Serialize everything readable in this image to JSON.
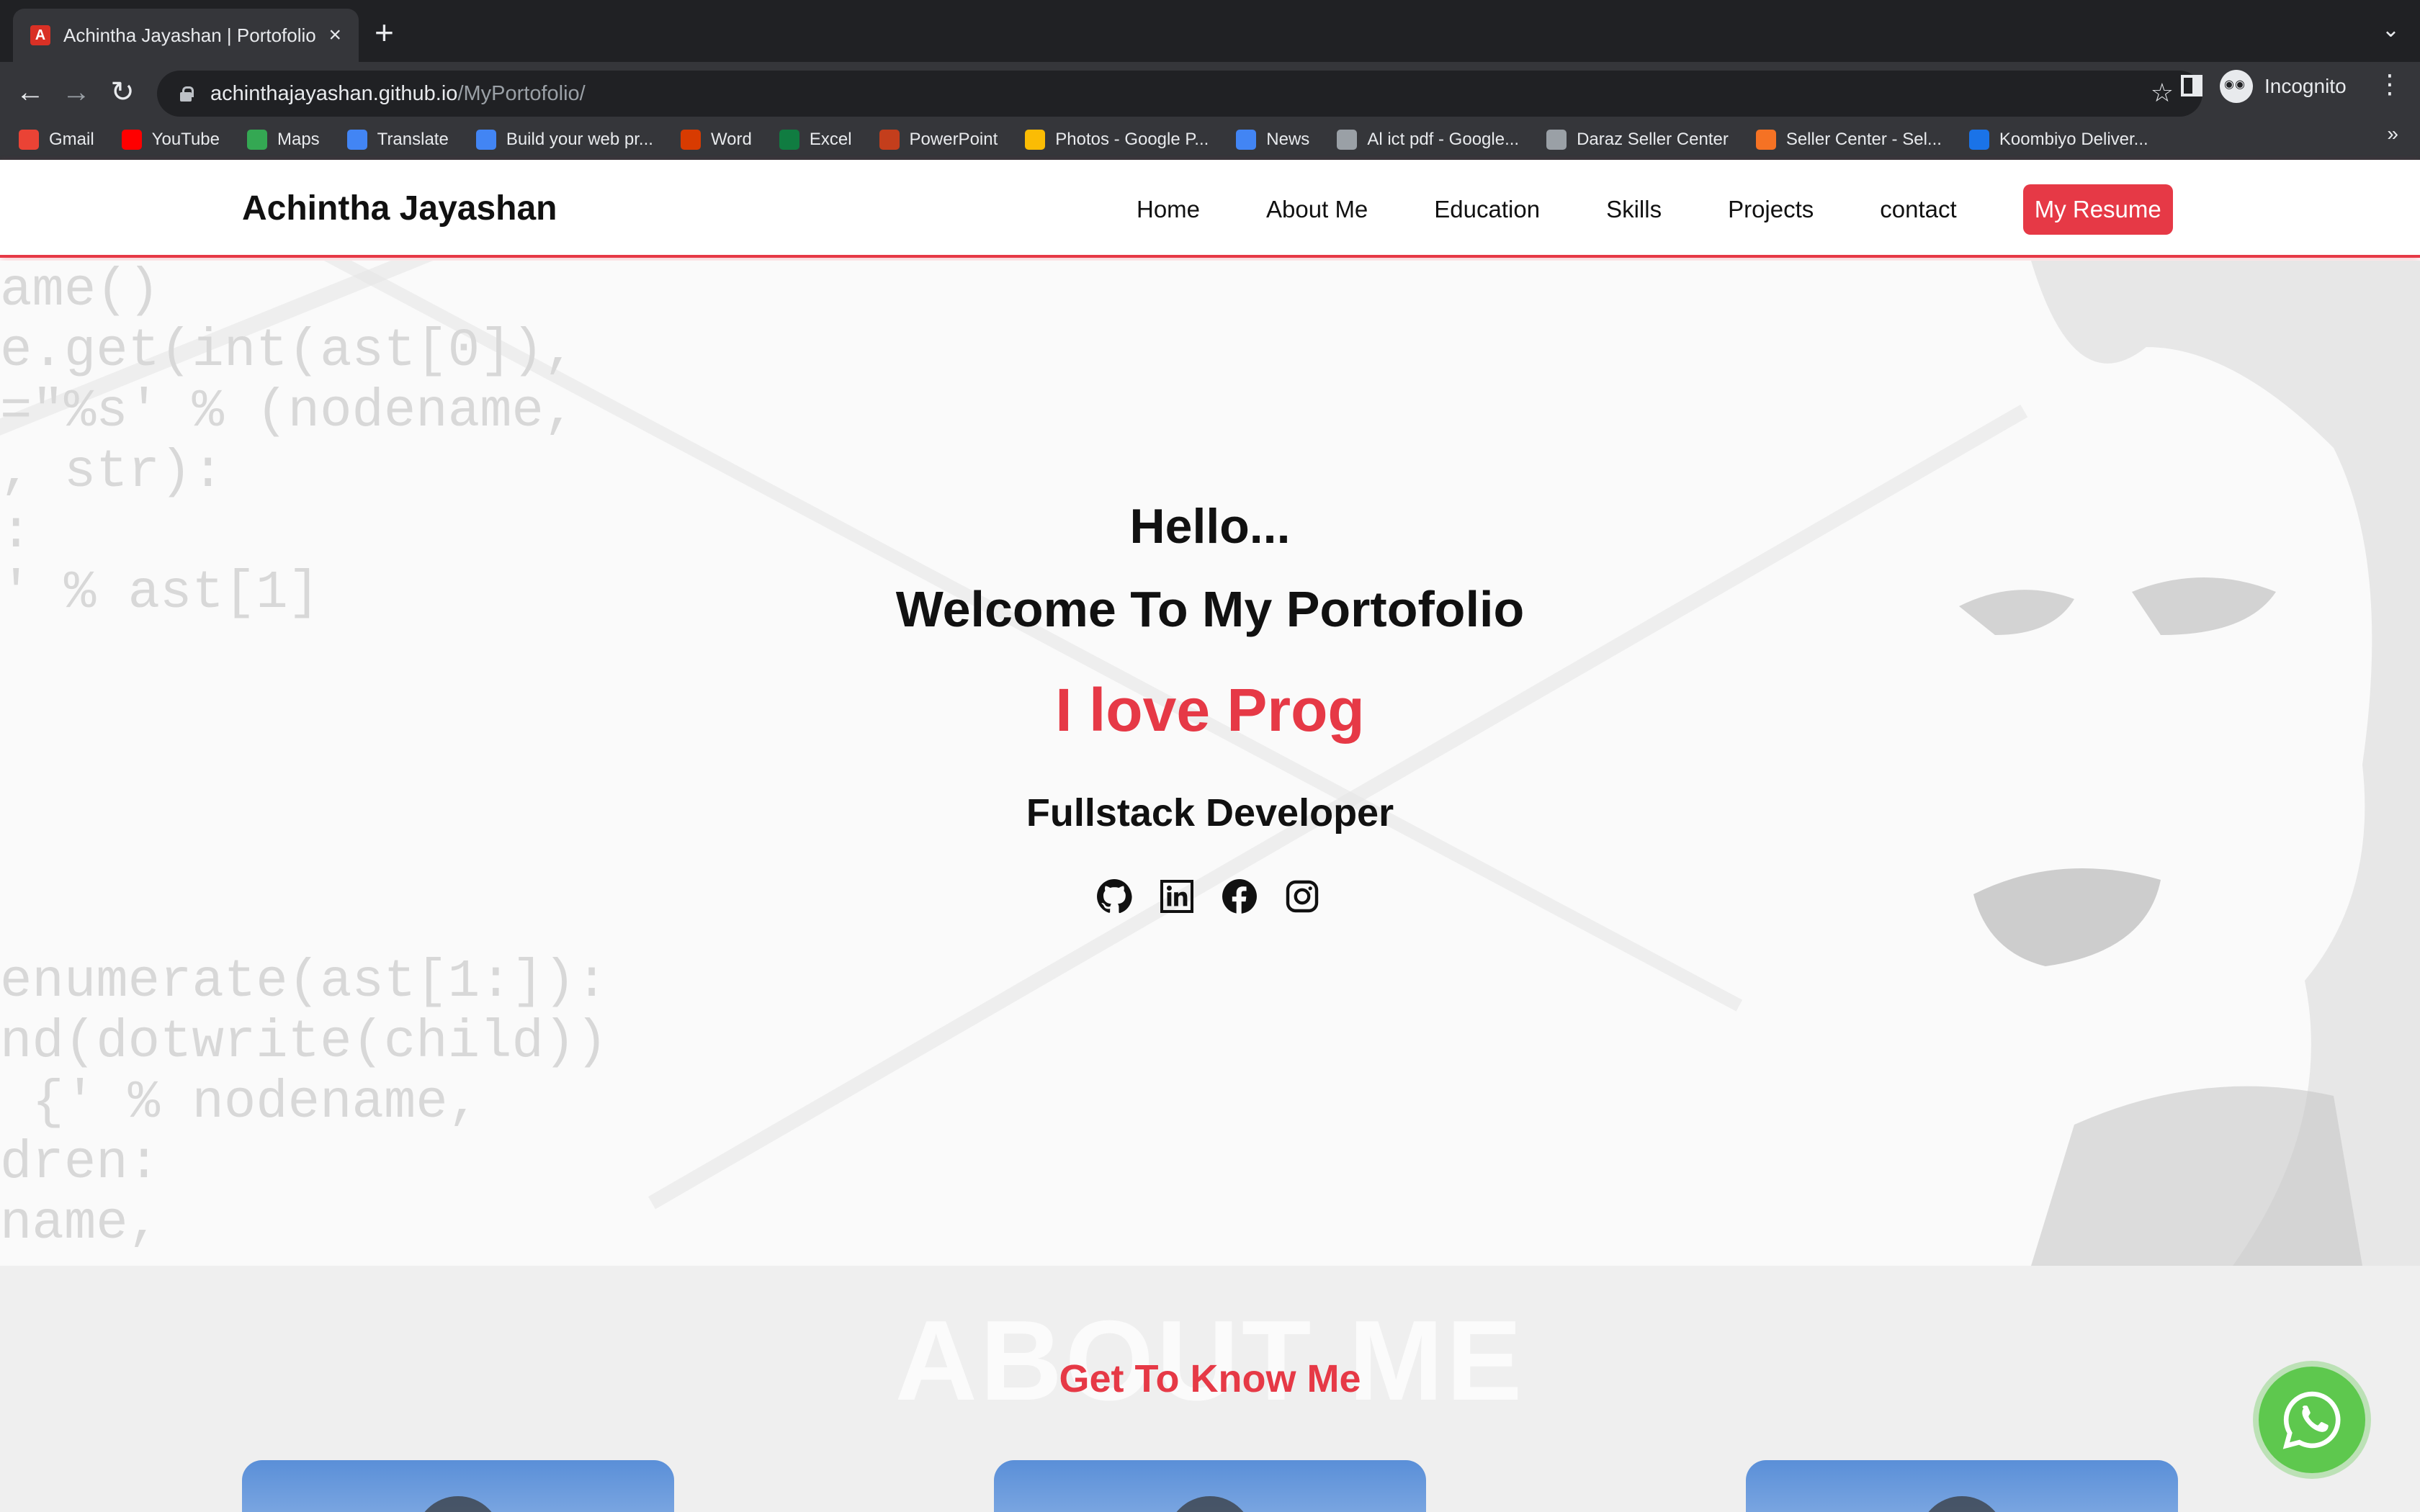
{
  "browser": {
    "tab_title": "Achintha Jayashan | Portofolio",
    "url_host": "achinthajayashan.github.io",
    "url_path": "/MyPortofolio/",
    "incognito_label": "Incognito",
    "bookmarks": [
      {
        "label": "Gmail",
        "icon": "gmail-icon",
        "color": "#ea4335"
      },
      {
        "label": "YouTube",
        "icon": "youtube-icon",
        "color": "#ff0000"
      },
      {
        "label": "Maps",
        "icon": "maps-icon",
        "color": "#34a853"
      },
      {
        "label": "Translate",
        "icon": "translate-icon",
        "color": "#4285f4"
      },
      {
        "label": "Build your web pr...",
        "icon": "google-icon",
        "color": "#4285f4"
      },
      {
        "label": "Word",
        "icon": "office-icon",
        "color": "#d83b01"
      },
      {
        "label": "Excel",
        "icon": "microsoft-icon",
        "color": "#107c41"
      },
      {
        "label": "PowerPoint",
        "icon": "powerpoint-icon",
        "color": "#c43e1c"
      },
      {
        "label": "Photos - Google P...",
        "icon": "photos-icon",
        "color": "#fbbc04"
      },
      {
        "label": "News",
        "icon": "news-icon",
        "color": "#4285f4"
      },
      {
        "label": "Al ict pdf - Google...",
        "icon": "globe-icon",
        "color": "#9aa0a6"
      },
      {
        "label": "Daraz Seller Center",
        "icon": "globe-icon",
        "color": "#9aa0a6"
      },
      {
        "label": "Seller Center - Sel...",
        "icon": "daraz-icon",
        "color": "#f57224"
      },
      {
        "label": "Koombiyo Deliver...",
        "icon": "koombiyo-icon",
        "color": "#1a73e8"
      }
    ]
  },
  "site": {
    "brand": "Achintha Jayashan",
    "nav": [
      "Home",
      "About Me",
      "Education",
      "Skills",
      "Projects",
      "contact"
    ],
    "resume_label": "My Resume",
    "accent": "#e63946"
  },
  "hero": {
    "hello": "Hello...",
    "welcome": "Welcome To My Portofolio",
    "typed": "I love Prog",
    "role": "Fullstack Developer",
    "socials": [
      "github-icon",
      "linkedin-icon",
      "facebook-icon",
      "instagram-icon"
    ],
    "code_upper": "ame()\ne.get(int(ast[0]),\n=\"%s' % (nodename,\n, str):\n:\n' % ast[1]",
    "code_lower": "enumerate(ast[1:]):\nnd(dotwrite(child))\n {' % nodename,\ndren:\nname,"
  },
  "about": {
    "watermark": "ABOUT ME",
    "subtitle": "Get To Know Me"
  }
}
